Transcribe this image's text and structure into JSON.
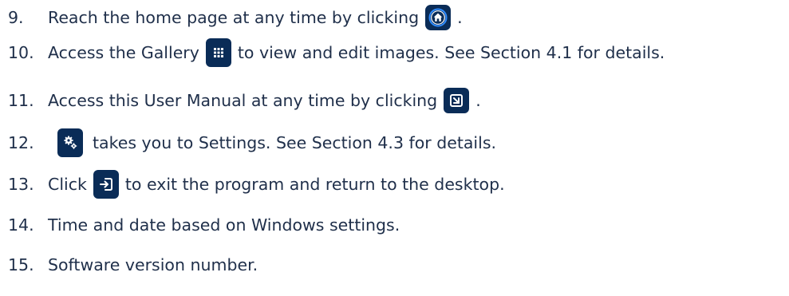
{
  "items": [
    {
      "number": "9.",
      "before": "Reach the home page at any time by clicking",
      "icon": "home-icon",
      "after": "."
    },
    {
      "number": "10.",
      "before": "Access the Gallery",
      "icon": "grid-icon",
      "after": "to view and edit images. See Section 4.1 for details."
    },
    {
      "number": "11.",
      "before": "Access this User Manual at any time by clicking",
      "icon": "manual-icon",
      "after": "."
    },
    {
      "number": "12.",
      "before": "",
      "icon": "settings-gears-icon",
      "after": "takes you to Settings. See Section 4.3 for details."
    },
    {
      "number": "13.",
      "before": "Click",
      "icon": "exit-icon",
      "after": "to exit the program and return to the desktop."
    },
    {
      "number": "14.",
      "before": "Time and date based on Windows settings.",
      "icon": "",
      "after": ""
    },
    {
      "number": "15.",
      "before": "Software version number.",
      "icon": "",
      "after": ""
    }
  ],
  "colors": {
    "text": "#1f2f4a",
    "icon_background": "#0a2c57",
    "icon_ring": "#2f8cff",
    "icon_glyph": "#ffffff"
  }
}
